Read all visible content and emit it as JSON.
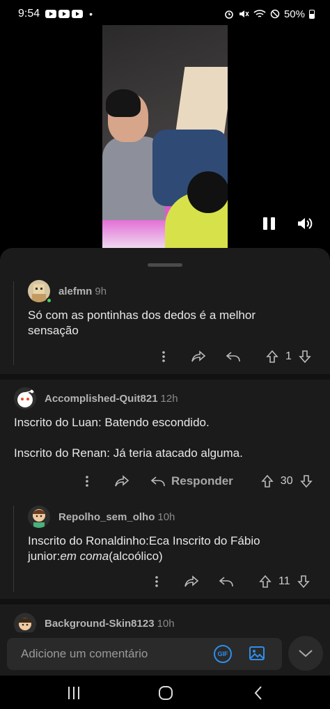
{
  "status_bar": {
    "time": "9:54",
    "dot": "•",
    "battery": "50%",
    "icons": [
      "youtube-icon",
      "youtube-icon",
      "youtube-icon",
      "alarm-icon",
      "mute-icon",
      "wifi-icon",
      "do-not-disturb-icon",
      "battery-icon"
    ]
  },
  "video": {
    "controls": [
      "pause-icon",
      "volume-icon"
    ]
  },
  "comments": [
    {
      "user": "alefmn",
      "ago": "9h",
      "text_lines": [
        "Só com as pontinhas dos dedos é a melhor",
        "sensação"
      ],
      "score": "1"
    },
    {
      "user": "Accomplished-Quit821",
      "ago": "12h",
      "line1": "Inscrito do Luan: Batendo escondido.",
      "line2": "Inscrito do Renan: Já teria atacado alguma.",
      "reply_label": "Responder",
      "score": "30"
    },
    {
      "user": "Repolho_sem_olho",
      "ago": "10h",
      "line1": "Inscrito do Ronaldinho:Eca Inscrito do Fábio",
      "line2_prefix": "junior:",
      "line2_italic": "em coma",
      "line2_suffix": "(alcoólico)",
      "score": "11"
    },
    {
      "user": "Background-Skin8123",
      "ago": "10h"
    }
  ],
  "composer": {
    "placeholder": "Adicione um comentário",
    "gif_label": "GIF"
  },
  "colors": {
    "background": "#1b1b1b",
    "accent": "#2f8eea",
    "online": "#46d160"
  }
}
